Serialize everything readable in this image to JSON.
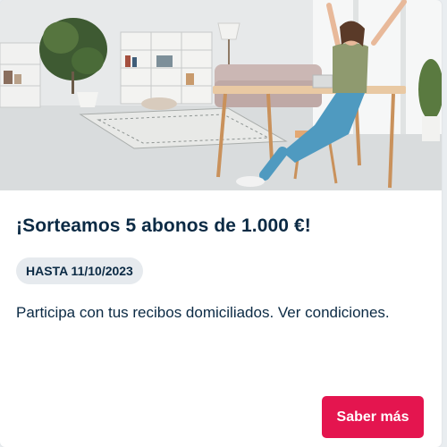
{
  "promo": {
    "title": "¡Sorteamos 5 abonos de 1.000 €!",
    "badge": "HASTA 11/10/2023",
    "description": "Participa con tus recibos domiciliados. Ver condiciones.",
    "cta_label": "Saber más"
  },
  "colors": {
    "text": "#0b2a44",
    "badge_bg": "#e6eaee",
    "cta_bg": "#e4154f",
    "cta_text": "#ffffff"
  },
  "icons": {
    "hero": "photo-woman-celebrating-at-desk"
  }
}
